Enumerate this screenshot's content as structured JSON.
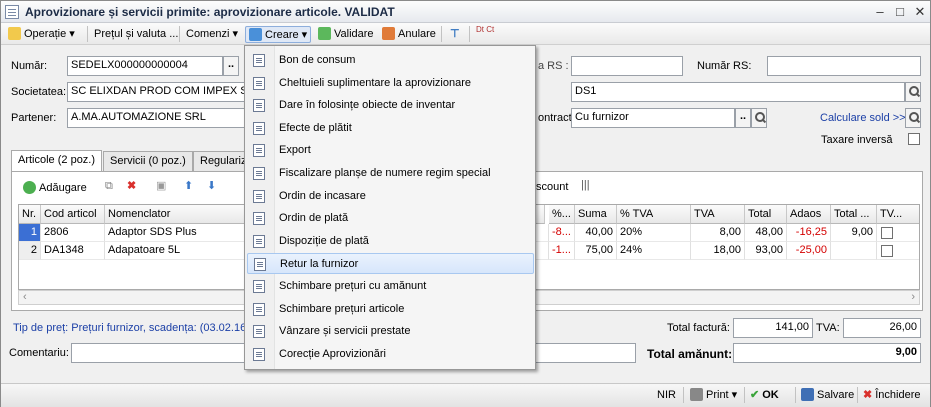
{
  "window": {
    "title": "Aprovizionare și servicii primite: aprovizionare articole. VALIDAT"
  },
  "toolbar": {
    "operatie": "Operație",
    "pretul_valuta": "Prețul și valuta ...",
    "comenzi": "Comenzi",
    "creare": "Creare",
    "validare": "Validare",
    "anulare": "Anulare",
    "dtct": "Dt Ct"
  },
  "form": {
    "numar_label": "Număr:",
    "numar_value": "SEDELX000000000004",
    "data_rs_label": "a RS :",
    "numar_rs_label": "Număr RS:",
    "societatea_label": "Societatea:",
    "societatea_value": "SC ELIXDAN PROD COM IMPEX SR",
    "depozit_value": "DS1",
    "partener_label": "Partener:",
    "partener_value": "A.MA.AUTOMAZIONE SRL",
    "contract_label": "ontract:",
    "contract_value": "Cu furnizor",
    "calculare_sold": "Calculare sold >>",
    "taxare_inversa": "Taxare inversă"
  },
  "tabs": [
    {
      "label": "Articole (2 poz.)"
    },
    {
      "label": "Servicii (0 poz.)"
    },
    {
      "label": "Regulariza"
    }
  ],
  "grid_toolbar": {
    "adaugare": "Adăugare",
    "discount": "scount"
  },
  "table": {
    "headers": [
      "Nr.",
      "Cod articol",
      "Nomenclator",
      "%...",
      "Suma",
      "% TVA",
      "TVA",
      "Total",
      "Adaos",
      "Total ...",
      "TV..."
    ],
    "rows": [
      {
        "nr": "1",
        "cod": "2806",
        "nomenclator": "Adaptor SDS Plus",
        "pct": "-8...",
        "suma": "40,00",
        "pct_tva": "20%",
        "tva": "8,00",
        "total": "48,00",
        "adaos": "-16,25",
        "total2": "9,00"
      },
      {
        "nr": "2",
        "cod": "DA1348",
        "nomenclator": "Adapatoare 5L",
        "pct": "-1...",
        "suma": "75,00",
        "pct_tva": "24%",
        "tva": "18,00",
        "total": "93,00",
        "adaos": "-25,00",
        "total2": ""
      }
    ]
  },
  "footer": {
    "tip_pret": "Tip de preț: Prețuri furnizor, scadența:",
    "scadenta": "(03.02.16)",
    "total_factura_label": "Total factură:",
    "total_factura": "141,00",
    "tva_label": "TVA:",
    "tva_value": "26,00",
    "comentariu_label": "Comentariu:",
    "total_amanunt_label": "Total amănunt:",
    "total_amanunt": "9,00"
  },
  "menu": {
    "items": [
      "Bon de consum",
      "Cheltuieli suplimentare la aprovizionare",
      "Dare în folosințe obiecte de inventar",
      "Efecte de plătit",
      "Export",
      "Fiscalizare planșe de numere regim special",
      "Ordin de incasare",
      "Ordin de plată",
      "Dispoziție de plată",
      "Retur la furnizor",
      "Schimbare prețuri cu amănunt",
      "Schimbare prețuri articole",
      "Vânzare și servicii prestate",
      "Corecție Aprovizionări"
    ],
    "highlighted_index": 9
  },
  "statusbar": {
    "nir": "NIR",
    "print": "Print",
    "ok": "OK",
    "salvare": "Salvare",
    "inchidere": "Închidere"
  }
}
